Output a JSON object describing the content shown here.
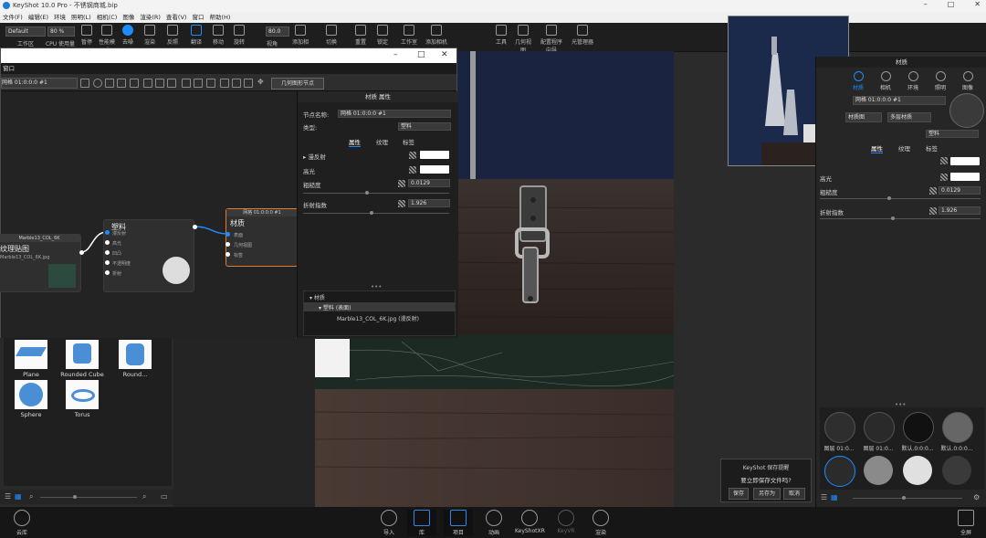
{
  "app": {
    "title": "KeyShot 10.0 Pro - 不锈钢商城.bip"
  },
  "menubar": [
    "文件(F)",
    "编辑(E)",
    "环境",
    "照明(L)",
    "相机(C)",
    "图像",
    "渲染(R)",
    "查看(V)",
    "窗口",
    "帮助(H)"
  ],
  "toolbar": {
    "workspace_value": "Default",
    "cpu_value": "80 %",
    "zoom_value": "80.0",
    "items": [
      "工作区",
      "CPU 使用量",
      "暂停",
      "性能模式",
      "去噪",
      "渲染",
      "区域",
      "反照",
      "翻译",
      "移动",
      "旋转",
      "平移",
      "推移",
      "视角",
      "添加相机",
      "重置",
      "锁定",
      "几何视图",
      "工作室",
      "几何视图",
      "添加相机",
      "配置程序向导",
      "渲染",
      "KeyShotXR",
      "光管理器"
    ]
  },
  "node_graph": {
    "menu_label": "窗口",
    "node_field": "网格 01:0:0:0 #1",
    "geometry_button": "几何图形节点",
    "texture_node": {
      "header": "Marble13_COL_6K",
      "title": "纹理贴图",
      "filename": "Marble13_COL_6K.jpg"
    },
    "plastic_node": {
      "title": "塑料",
      "ports": [
        "漫反射",
        "高光",
        "凹凸",
        "不透明度",
        "折射"
      ]
    },
    "material_node": {
      "header": "网格 01:0:0:0 #1",
      "title": "材质",
      "ports": [
        "表面",
        "几何视图",
        "标签"
      ]
    },
    "props": {
      "header": "材质 属性",
      "node_name_label": "节点名称:",
      "node_name_value": "网格 01:0:0:0 #1",
      "type_label": "类型:",
      "type_value": "塑料",
      "tabs": [
        "属性",
        "纹理",
        "标签"
      ],
      "diffuse": "漫反射",
      "specular": "高光",
      "roughness": "粗糙度",
      "roughness_value": "0.0129",
      "ior": "折射指数",
      "ior_value": "1.926",
      "tree": [
        "材质",
        "塑料 (表面)",
        "Marble13_COL_6K.jpg (漫反射)"
      ]
    }
  },
  "library": {
    "items": [
      "Plane",
      "Rounded Cube",
      "Round...",
      "Sphere",
      "Torus"
    ]
  },
  "right_panel": {
    "header": "材质",
    "tabs": [
      "材质",
      "相机",
      "环境",
      "照明",
      "图像"
    ],
    "name_field": "网格 01:0:0:0 #1",
    "graph_button": "材质图",
    "multi_button": "多层材质",
    "type_value": "塑料",
    "prop_tabs": [
      "属性",
      "纹理",
      "标签"
    ],
    "specular": "高光",
    "roughness": "粗糙度",
    "roughness_value": "0.0129",
    "ior": "折射指数",
    "ior_value": "1.926",
    "materials": [
      "图层 01:0...",
      "图层 01:0...",
      "默认.0:0:0...",
      "默认.0:0:0..."
    ]
  },
  "dialog": {
    "title": "KeyShot 保存提醒",
    "question": "要立即保存文件吗?",
    "buttons": [
      "保存",
      "另存为",
      "取消"
    ]
  },
  "bottom": {
    "left": "云库",
    "items": [
      "导入",
      "库",
      "项目",
      "动画",
      "KeyShotXR",
      "KeyVR",
      "渲染"
    ],
    "right": "全屏"
  },
  "colors": {
    "accent": "#1e8cff",
    "node_highlight": "#e07b2a"
  }
}
